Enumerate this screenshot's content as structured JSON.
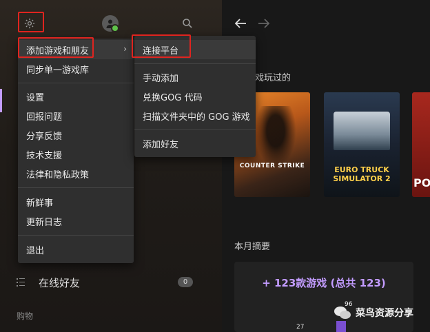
{
  "sidebar": {
    "online_friends_label": "在线好友",
    "online_friends_count": "0",
    "purchase_section": "购物"
  },
  "menu": {
    "items": [
      {
        "label": "添加游戏和朋友",
        "has_submenu": true
      },
      {
        "label": "同步单一游戏库"
      },
      {
        "label": "设置"
      },
      {
        "label": "回报问题"
      },
      {
        "label": "分享反馈"
      },
      {
        "label": "技术支援"
      },
      {
        "label": "法律和隐私政策"
      },
      {
        "label": "新鲜事"
      },
      {
        "label": "更新日志"
      },
      {
        "label": "退出"
      }
    ]
  },
  "submenu": {
    "items": [
      {
        "label": "连接平台"
      },
      {
        "label": "手动添加"
      },
      {
        "label": "兑换GOG 代码"
      },
      {
        "label": "扫描文件夹中的 GOG 游戏"
      },
      {
        "label": "添加好友"
      }
    ]
  },
  "main": {
    "recent_title_partial": "戏玩过的",
    "games": [
      {
        "title": "COUNTER STRIKE"
      },
      {
        "title": "EURO TRUCK SIMULATOR 2"
      },
      {
        "title": "PO"
      }
    ],
    "monthly_title": "本月摘要",
    "games_added": "+ 123款游戏 (总共 123)",
    "bottom_number": "27"
  },
  "watermark": {
    "text": "菜鸟资源分享",
    "badge": "96"
  },
  "colors": {
    "accent_red": "#e0241f",
    "purple": "#c39cff",
    "online_green": "#5fc24a"
  }
}
